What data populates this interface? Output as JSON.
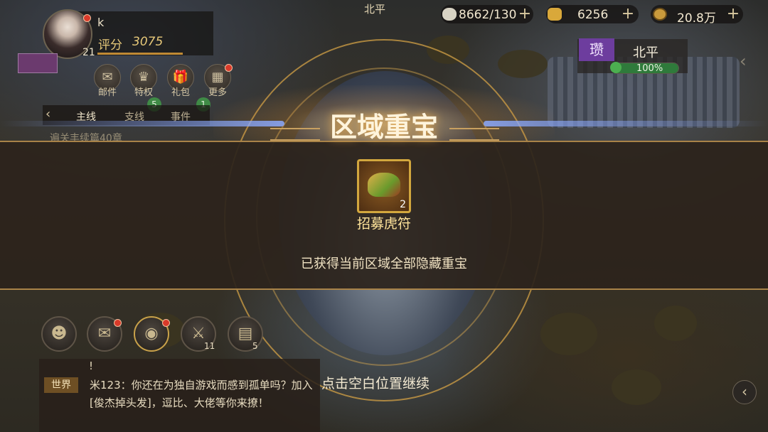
{
  "top_bar": {
    "location": "北平",
    "stamina": "8662/130",
    "gold": "6256",
    "copper": "20.8万"
  },
  "player": {
    "name": "k",
    "score_label": "评分",
    "score": "3075",
    "level": "21"
  },
  "menu": {
    "items": [
      {
        "label": "邮件",
        "icon": "mail-icon"
      },
      {
        "label": "特权",
        "icon": "privilege-icon",
        "badge": "5"
      },
      {
        "label": "礼包",
        "icon": "gift-icon",
        "badge": "1"
      },
      {
        "label": "更多",
        "icon": "more-icon"
      }
    ]
  },
  "quest_tabs": {
    "tabs": [
      "主线",
      "支线",
      "事件"
    ],
    "current": "遍关丰续篇40章"
  },
  "city_panel": {
    "badge": "瓒",
    "city": "北平",
    "progress": "100%",
    "progress_fraction": 1.0
  },
  "reward": {
    "title": "区域重宝",
    "item_name": "招募虎符",
    "item_count": "2",
    "message": "已获得当前区域全部隐藏重宝"
  },
  "bottom_bar": {
    "icons": [
      {
        "name": "hero-icon"
      },
      {
        "name": "scroll-icon"
      },
      {
        "name": "eye-icon"
      },
      {
        "name": "sword-icon",
        "count": "11"
      },
      {
        "name": "map-icon",
        "count": "5"
      }
    ]
  },
  "chat": {
    "prev_line": "!",
    "channel": "世界",
    "message": "米123：你还在为独自游戏而感到孤单吗？加入[俊杰掉头发]，逗比、大佬等你来撩！"
  },
  "continue_hint": "点击空白位置继续",
  "colors": {
    "gold_border": "#a98348",
    "panel_bg": "#2c241c",
    "title_text": "#fff4dc"
  }
}
